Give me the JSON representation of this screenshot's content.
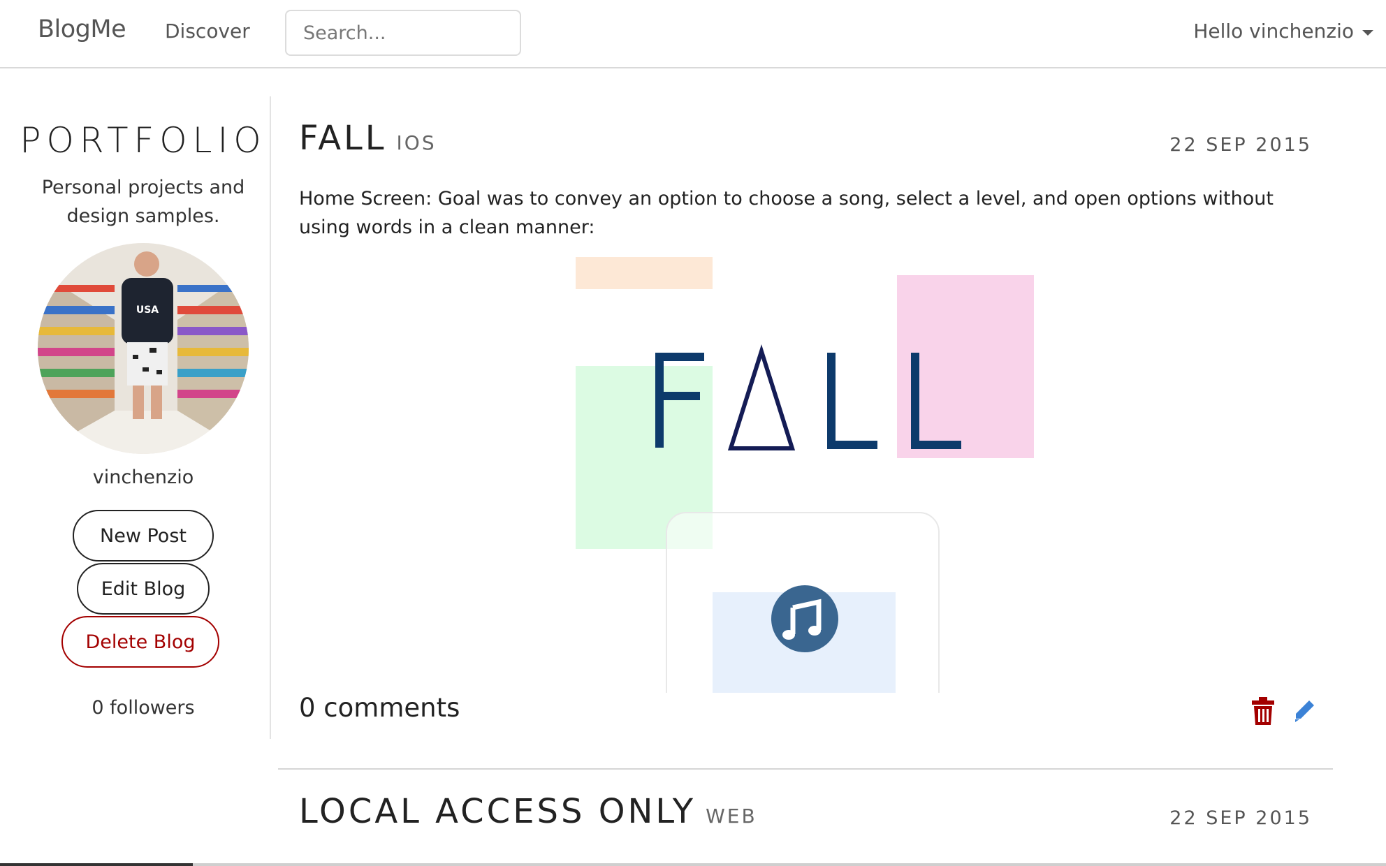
{
  "navbar": {
    "brand": "BlogMe",
    "discover_label": "Discover",
    "search_placeholder": "Search...",
    "user_greeting": "Hello vinchenzio"
  },
  "sidebar": {
    "title": "PORTFOLIO",
    "description": "Personal projects and design samples.",
    "username": "vinchenzio",
    "new_post_label": "New Post",
    "edit_blog_label": "Edit Blog",
    "delete_blog_label": "Delete Blog",
    "followers": "0 followers",
    "avatar_icon": "profile-photo"
  },
  "posts": [
    {
      "title": "FALL",
      "tag": "IOS",
      "date": "22 SEP 2015",
      "body": "Home Screen: Goal was to convey an option to choose a song, select a level, and open options without using words in a clean manner:",
      "image_text": "FALL",
      "image_icon": "music-note-icon",
      "comments": "0 comments",
      "delete_icon": "trash-icon",
      "edit_icon": "pencil-icon"
    },
    {
      "title": "LOCAL ACCESS ONLY",
      "tag": "WEB",
      "date": "22 SEP 2015"
    }
  ],
  "colors": {
    "danger": "#a30000",
    "edit_blue": "#3b82d6",
    "image_navy": "#0d3a6b",
    "peach": "#fde8d6",
    "pink": "#f9d3ea",
    "mint": "#dcfbe3",
    "light_blue": "#e7f0fc",
    "music_circle": "#3a6690"
  }
}
